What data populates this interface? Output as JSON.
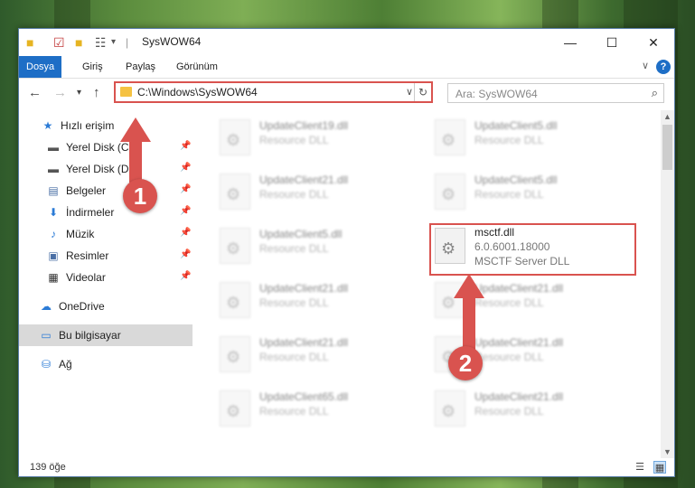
{
  "window": {
    "title": "SysWOW64",
    "minimize_icon": "minimize-icon",
    "maximize_icon": "maximize-icon",
    "close_icon": "close-icon"
  },
  "ribbon": {
    "tabs": [
      {
        "label": "Dosya",
        "active": true
      },
      {
        "label": "Giriş",
        "active": false
      },
      {
        "label": "Paylaş",
        "active": false
      },
      {
        "label": "Görünüm",
        "active": false
      }
    ],
    "help": "?"
  },
  "navbar": {
    "address": "C:\\Windows\\SysWOW64",
    "search_placeholder": "Ara: SysWOW64"
  },
  "sidebar": {
    "items": [
      {
        "label": "Hızlı erişim",
        "icon": "star-icon",
        "pinned": false
      },
      {
        "label": "Yerel Disk (C:)",
        "icon": "drive-icon",
        "pinned": true
      },
      {
        "label": "Yerel Disk (D:)",
        "icon": "drive-icon",
        "pinned": true
      },
      {
        "label": "Belgeler",
        "icon": "documents-icon",
        "pinned": true
      },
      {
        "label": "İndirmeler",
        "icon": "download-icon",
        "pinned": true
      },
      {
        "label": "Müzik",
        "icon": "music-icon",
        "pinned": true
      },
      {
        "label": "Resimler",
        "icon": "pictures-icon",
        "pinned": true
      },
      {
        "label": "Videolar",
        "icon": "video-icon",
        "pinned": true
      },
      {
        "label": "OneDrive",
        "icon": "cloud-icon",
        "pinned": false
      },
      {
        "label": "Bu bilgisayar",
        "icon": "computer-icon",
        "pinned": false,
        "selected": true
      },
      {
        "label": "Ağ",
        "icon": "network-icon",
        "pinned": false
      }
    ]
  },
  "files": {
    "left": [
      {
        "name": "UpdateClient19.dll",
        "desc": "Resource DLL"
      },
      {
        "name": "UpdateClient21.dll",
        "desc": "Resource DLL"
      },
      {
        "name": "UpdateClient5.dll",
        "desc": "Resource DLL"
      },
      {
        "name": "UpdateClient21.dll",
        "desc": "Resource DLL"
      },
      {
        "name": "UpdateClient21.dll",
        "desc": "Resource DLL"
      },
      {
        "name": "UpdateClient65.dll",
        "desc": "Resource DLL"
      }
    ],
    "right": [
      {
        "name": "UpdateClient5.dll",
        "desc": "Resource DLL"
      },
      {
        "name": "UpdateClient5.dll",
        "desc": "Resource DLL"
      },
      {
        "name": "UpdateClient21.dll",
        "desc": "Resource DLL"
      },
      {
        "name": "UpdateClient21.dll",
        "desc": "Resource DLL"
      },
      {
        "name": "UpdateClient21.dll",
        "desc": "Resource DLL"
      }
    ],
    "highlighted": {
      "name": "msctf.dll",
      "version": "6.0.6001.18000",
      "desc": "MSCTF Server DLL"
    }
  },
  "status": {
    "count": "139 öğe"
  },
  "annotations": {
    "badge1": "1",
    "badge2": "2",
    "color": "#d9534f"
  }
}
